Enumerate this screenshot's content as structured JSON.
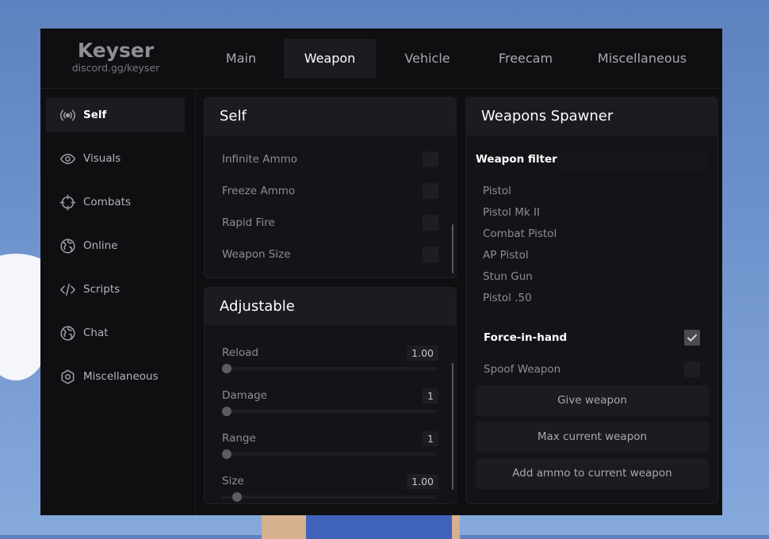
{
  "brand": {
    "title": "Keyser",
    "subtitle": "discord.gg/keyser"
  },
  "tabs": [
    {
      "label": "Main"
    },
    {
      "label": "Weapon"
    },
    {
      "label": "Vehicle"
    },
    {
      "label": "Freecam"
    },
    {
      "label": "Miscellaneous"
    }
  ],
  "active_tab": "Weapon",
  "sidebar": {
    "items": [
      {
        "label": "Self",
        "icon": "broadcast-icon"
      },
      {
        "label": "Visuals",
        "icon": "eye-icon"
      },
      {
        "label": "Combats",
        "icon": "crosshair-icon"
      },
      {
        "label": "Online",
        "icon": "globe-icon"
      },
      {
        "label": "Scripts",
        "icon": "code-icon"
      },
      {
        "label": "Chat",
        "icon": "globe-icon"
      },
      {
        "label": "Miscellaneous",
        "icon": "gear-icon"
      }
    ],
    "active": "Self"
  },
  "self_panel": {
    "title": "Self",
    "options": [
      {
        "label": "Infinite Ammo",
        "checked": false
      },
      {
        "label": "Freeze Ammo",
        "checked": false
      },
      {
        "label": "Rapid Fire",
        "checked": false
      },
      {
        "label": "Weapon Size",
        "checked": false
      }
    ]
  },
  "adjustable_panel": {
    "title": "Adjustable",
    "sliders": [
      {
        "label": "Reload",
        "value": "1.00",
        "fraction": 0
      },
      {
        "label": "Damage",
        "value": "1",
        "fraction": 0
      },
      {
        "label": "Range",
        "value": "1",
        "fraction": 0
      },
      {
        "label": "Size",
        "value": "1.00",
        "fraction": 0.05
      }
    ]
  },
  "spawner_panel": {
    "title": "Weapons Spawner",
    "filter_label": "Weapon filter",
    "filter_value": "",
    "weapons": [
      "Pistol",
      "Pistol Mk II",
      "Combat Pistol",
      "AP Pistol",
      "Stun Gun",
      "Pistol .50"
    ],
    "options": [
      {
        "label": "Force-in-hand",
        "checked": true
      },
      {
        "label": "Spoof Weapon",
        "checked": false
      }
    ],
    "buttons": [
      {
        "label": "Give weapon"
      },
      {
        "label": "Max current weapon"
      },
      {
        "label": "Add ammo to current weapon"
      }
    ]
  },
  "colors": {
    "window_bg": "#0f0f12",
    "panel_bg": "#141418",
    "active_bg": "#1b1b20",
    "text_muted": "#8c8c94"
  }
}
